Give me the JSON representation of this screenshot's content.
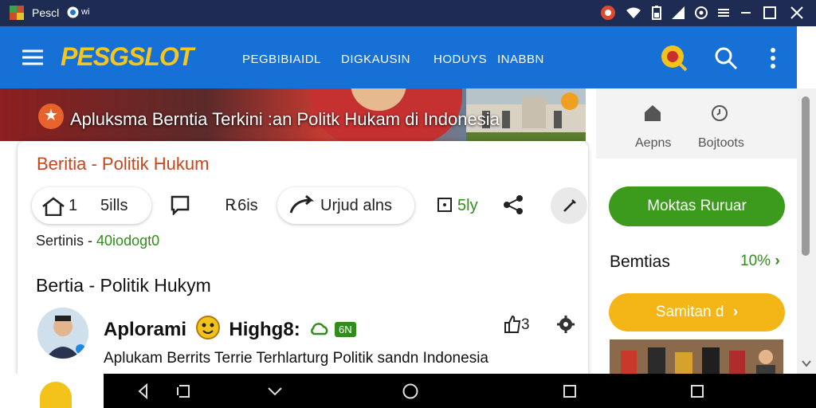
{
  "titlebar": {
    "app_name": "Pescl",
    "dot_label": "wi",
    "icons": [
      "app-icon",
      "record-icon",
      "wifi-icon",
      "battery-icon",
      "signal-icon",
      "settings-icon",
      "window-icon",
      "minimize-icon",
      "maximize-icon",
      "close-icon"
    ]
  },
  "header": {
    "logo": "PESGSLOT",
    "nav": [
      "PEGBIBIAIDL",
      "DIGKAUSIN",
      "HODUYS",
      "INABBN"
    ],
    "icons": [
      "menu-icon",
      "promo-icon",
      "search-icon",
      "more-icon"
    ]
  },
  "hero": {
    "text": "Apluksma Berntia Terkini :an Politk Hukam di Indonesia"
  },
  "card": {
    "title": "Beritia - Politik Hukum",
    "actions": [
      {
        "count": "1",
        "label": "5ills"
      },
      {
        "label": "Ꭱ6is"
      },
      {
        "label": "Urjud alns"
      },
      {
        "label": "5ly"
      }
    ],
    "subline_label": "Sertinis -",
    "subline_value": "40iodogt0",
    "section_title": "Bertia - Politik Hukym",
    "post": {
      "name": "Aplorami",
      "name2": "Highg8:",
      "badge": "6N",
      "likes": "3",
      "body": "Aplukam Berrits Terrie Terhlarturg Politik sandn Indonesia"
    }
  },
  "sidebar": {
    "tabs": [
      "Aepns",
      "Bojtoots"
    ],
    "green_button": "Moktas Ruruar",
    "label": "Bemtias",
    "pct": "10%",
    "yellow_button": "Samitan d"
  },
  "colors": {
    "titlebar": "#1e2b52",
    "appbar": "#1670d6",
    "logo": "#f6c61b",
    "accent_green": "#3c9a1c",
    "accent_yellow": "#f4b617",
    "accent_orange": "#c6451c"
  }
}
